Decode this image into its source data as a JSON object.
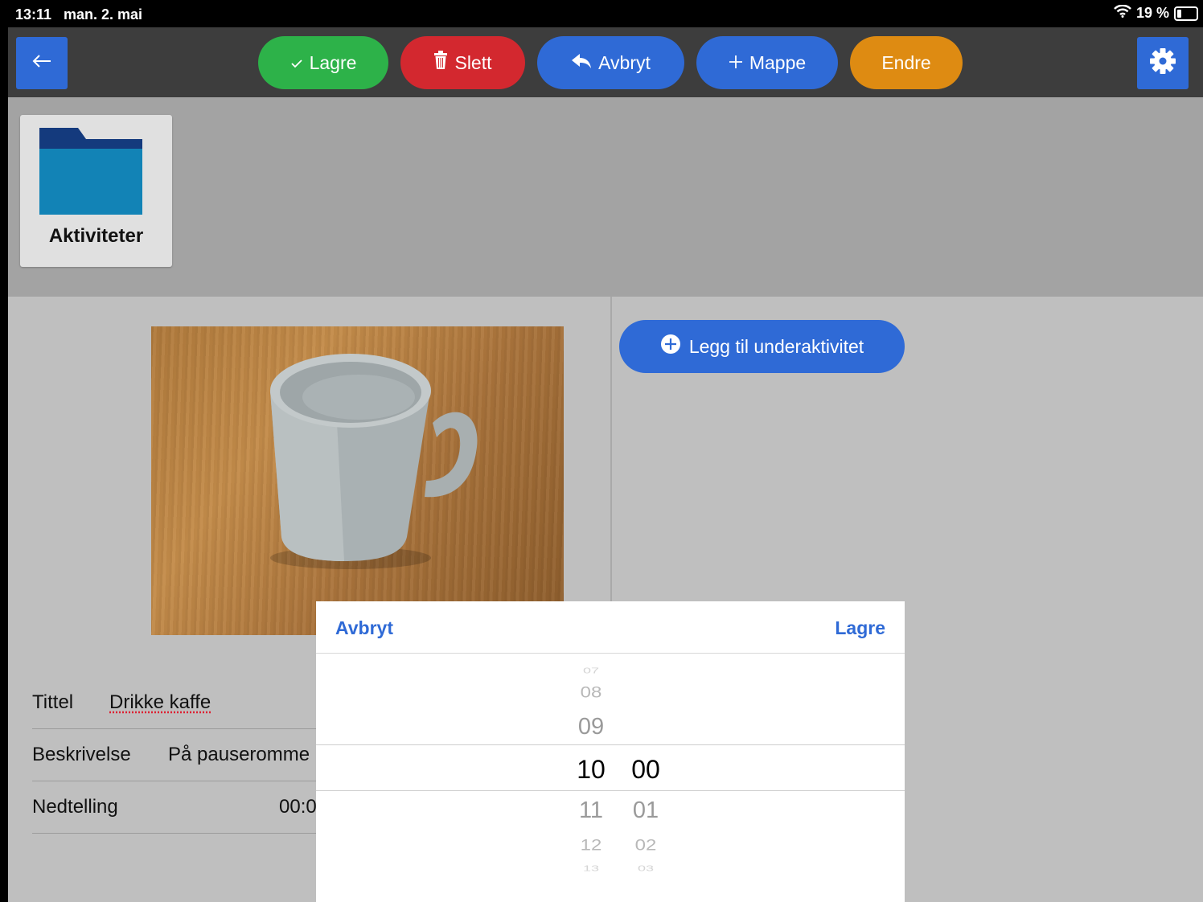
{
  "status_bar": {
    "time": "13:11",
    "date": "man. 2. mai",
    "battery": "19 %",
    "battery_level": 0.19
  },
  "toolbar": {
    "back_icon": "arrow-left-icon",
    "settings_icon": "gear-icon",
    "lagre_label": "Lagre",
    "slett_label": "Slett",
    "avbryt_label": "Avbryt",
    "mappe_label": "Mappe",
    "endre_label": "Endre"
  },
  "folder": {
    "label": "Aktiviteter"
  },
  "activity": {
    "add_subactivity_label": "Legg til underaktivitet",
    "fields": {
      "title_label": "Tittel",
      "title_value": "Drikke kaffe",
      "description_label": "Beskrivelse",
      "description_value": "På pauseromme",
      "countdown_label": "Nedtelling",
      "countdown_value": "00:0"
    }
  },
  "time_picker": {
    "cancel_label": "Avbryt",
    "save_label": "Lagre",
    "hours": {
      "above_far": "07",
      "above_2": "08",
      "above_1": "09",
      "selected": "10",
      "below_1": "11",
      "below_2": "12",
      "below_far": "13"
    },
    "minutes": {
      "selected": "00",
      "below_1": "01",
      "below_2": "02",
      "below_far": "03"
    }
  },
  "colors": {
    "blue": "#2f6ad6",
    "green": "#2db249",
    "red": "#d3282f",
    "orange": "#de8b12",
    "toolbar_bg": "#3d3d3d"
  }
}
